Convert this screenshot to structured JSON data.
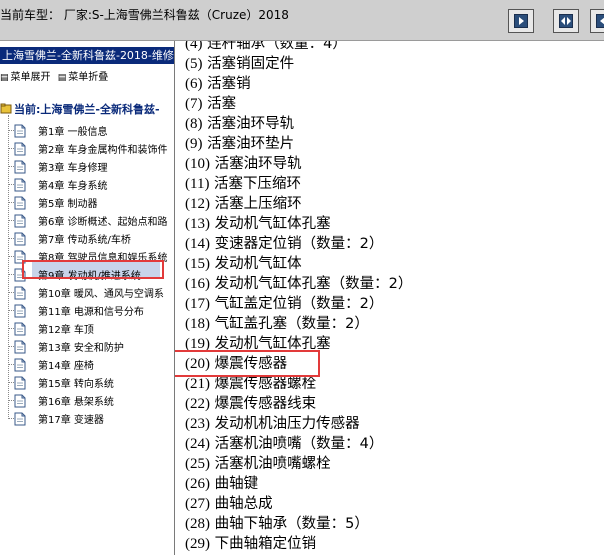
{
  "header": {
    "title": "当前车型：  厂家:S-上海雪佛兰科鲁兹（Cruze）2018",
    "buttons": [
      {
        "name": "expand-right-icon"
      },
      {
        "name": "split-view-icon"
      },
      {
        "name": "expand-left-icon"
      }
    ]
  },
  "left_panel": {
    "title": "上海雪佛兰-全新科鲁兹-2018-维修",
    "menu": {
      "expand": "菜单展开",
      "collapse": "菜单折叠"
    },
    "current": "当前:上海雪佛兰-全新科鲁兹-",
    "chapters": [
      "第1章 一般信息",
      "第2章 车身金属构件和装饰件",
      "第3章 车身修理",
      "第4章 车身系统",
      "第5章 制动器",
      "第6章 诊断概述、起始点和路",
      "第7章 传动系统/车桥",
      "第8章 驾驶员信息和娱乐系统",
      "第9章 发动机/推进系统",
      "第10章 暖风、通风与空调系",
      "第11章 电源和信号分布",
      "第12章 车顶",
      "第13章 安全和防护",
      "第14章 座椅",
      "第15章 转向系统",
      "第16章 悬架系统",
      "第17章 变速器"
    ],
    "selected_index": 8
  },
  "parts_list": [
    {
      "num": "(4)",
      "text": "连杆轴承（数量：4）"
    },
    {
      "num": "(5)",
      "text": "活塞销固定件"
    },
    {
      "num": "(6)",
      "text": "活塞销"
    },
    {
      "num": "(7)",
      "text": "活塞"
    },
    {
      "num": "(8)",
      "text": "活塞油环导轨"
    },
    {
      "num": "(9)",
      "text": "活塞油环垫片"
    },
    {
      "num": "(10)",
      "text": "活塞油环导轨"
    },
    {
      "num": "(11)",
      "text": "活塞下压缩环"
    },
    {
      "num": "(12)",
      "text": "活塞上压缩环"
    },
    {
      "num": "(13)",
      "text": "发动机气缸体孔塞"
    },
    {
      "num": "(14)",
      "text": "变速器定位销（数量：2）"
    },
    {
      "num": "(15)",
      "text": "发动机气缸体"
    },
    {
      "num": "(16)",
      "text": "发动机气缸体孔塞（数量：2）"
    },
    {
      "num": "(17)",
      "text": "气缸盖定位销（数量：2）"
    },
    {
      "num": "(18)",
      "text": "气缸盖孔塞（数量：2）"
    },
    {
      "num": "(19)",
      "text": "发动机气缸体孔塞"
    },
    {
      "num": "(20)",
      "text": "爆震传感器"
    },
    {
      "num": "(21)",
      "text": "爆震传感器螺栓"
    },
    {
      "num": "(22)",
      "text": "爆震传感器线束"
    },
    {
      "num": "(23)",
      "text": "发动机机油压力传感器"
    },
    {
      "num": "(24)",
      "text": "活塞机油喷嘴（数量：4）"
    },
    {
      "num": "(25)",
      "text": "活塞机油喷嘴螺栓"
    },
    {
      "num": "(26)",
      "text": "曲轴键"
    },
    {
      "num": "(27)",
      "text": "曲轴总成"
    },
    {
      "num": "(28)",
      "text": "曲轴下轴承（数量：5）"
    },
    {
      "num": "(29)",
      "text": "下曲轴箱定位销"
    }
  ],
  "highlighted_part_index": 16,
  "colors": {
    "title_bar": "#0a2a7a",
    "highlight_box": "#e23a3a",
    "header_bg": "#cfcfcf"
  }
}
